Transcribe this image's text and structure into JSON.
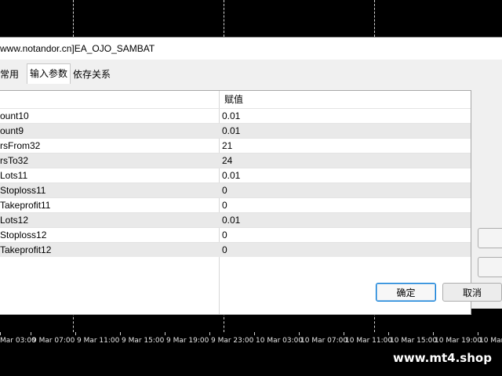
{
  "dialog": {
    "title": "www.notandor.cn]EA_OJO_SAMBAT",
    "tabs": [
      "常用",
      "输入参数",
      "依存关系"
    ],
    "grid": {
      "value_header": "赋值",
      "rows": [
        {
          "name": "ount10",
          "value": "0.01"
        },
        {
          "name": "ount9",
          "value": "0.01"
        },
        {
          "name": "rsFrom32",
          "value": "21"
        },
        {
          "name": "rsTo32",
          "value": "24"
        },
        {
          "name": "Lots11",
          "value": "0.01"
        },
        {
          "name": "Stoploss11",
          "value": "0"
        },
        {
          "name": "Takeprofit11",
          "value": "0"
        },
        {
          "name": "Lots12",
          "value": "0.01"
        },
        {
          "name": "Stoploss12",
          "value": "0"
        },
        {
          "name": "Takeprofit12",
          "value": "0"
        }
      ]
    },
    "ok_label": "确定",
    "cancel_label": "取消"
  },
  "chart": {
    "time_labels": [
      "Mar 03:00",
      "9 Mar 07:00",
      "9 Mar 11:00",
      "9 Mar 15:00",
      "9 Mar 19:00",
      "9 Mar 23:00",
      "10 Mar 03:00",
      "10 Mar 07:00",
      "10 Mar 11:00",
      "10 Mar 15:00",
      "10 Mar 19:00",
      "10 Mar"
    ]
  },
  "watermark": "www.mt4.shop"
}
